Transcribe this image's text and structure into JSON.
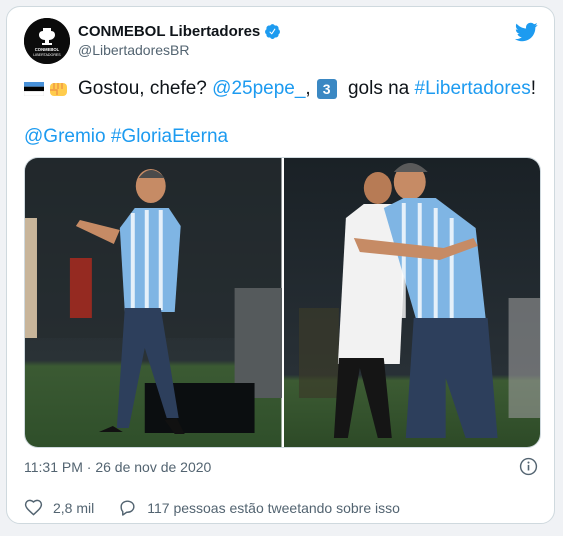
{
  "tweet": {
    "author": {
      "name": "CONMEBOL Libertadores",
      "handle": "@LibertadoresBR",
      "verified": true,
      "avatar_text": "CONMEBOL\nLIBERTADORES"
    },
    "text": {
      "prefix": "Gostou, chefe? ",
      "mention_pepe": "@25pepe_",
      "comma": ",",
      "number_emoji": "3",
      "middle": " gols na ",
      "hashtag_lib": "#Libertadores",
      "exclaim": "!",
      "mention_gremio": "@Gremio",
      "hashtag_gloria": "#GloriaEterna"
    },
    "timestamp": "11:31 PM · 26 de nov de 2020",
    "likes": "2,8 mil",
    "tweeting": "117 pessoas estão tweetando sobre isso"
  },
  "colors": {
    "link": "#1d9bf0",
    "verified": "#1d9bf0",
    "twitter": "#1d9bf0",
    "muted": "#536471"
  },
  "icons": [
    "verified-badge-icon",
    "twitter-bird-icon",
    "info-icon",
    "heart-icon",
    "reply-icon",
    "estonia-flag-icon",
    "fist-emoji-icon",
    "keycap-3-icon"
  ]
}
